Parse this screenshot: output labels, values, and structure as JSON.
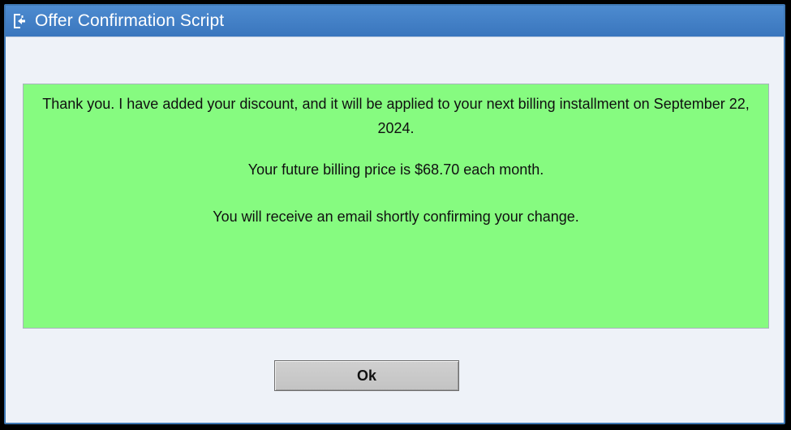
{
  "window": {
    "title": "Offer Confirmation Script",
    "icon": "app-window-icon"
  },
  "message": {
    "line1": "Thank you. I have added your discount, and it will be applied to your next billing installment on September 22, 2024.",
    "line2": "Your future billing price is $68.70 each month.",
    "line3": "You will receive an email shortly confirming your change.",
    "background_color": "#86fb80"
  },
  "buttons": {
    "ok_label": "Ok"
  },
  "colors": {
    "titlebar": "#3f7fc6",
    "title_text": "#ffffff",
    "panel_bg": "#86fb80"
  }
}
